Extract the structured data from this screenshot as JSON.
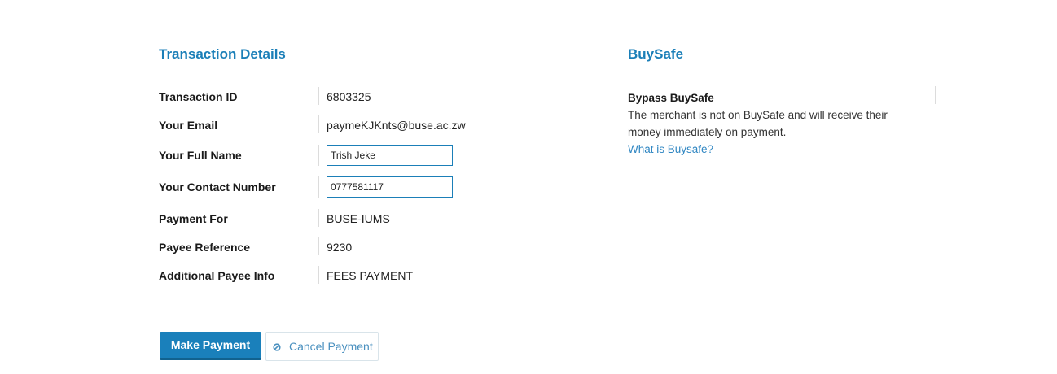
{
  "transaction": {
    "title": "Transaction Details",
    "rows": [
      {
        "label": "Transaction ID",
        "value": "6803325"
      },
      {
        "label": "Your Email",
        "value": "paymeKJKnts@buse.ac.zw"
      },
      {
        "label": "Your Full Name",
        "value": "Trish Jeke"
      },
      {
        "label": "Your Contact Number",
        "value": "0777581117"
      },
      {
        "label": "Payment For",
        "value": "BUSE-IUMS"
      },
      {
        "label": "Payee Reference",
        "value": "9230"
      },
      {
        "label": "Additional Payee Info",
        "value": "FEES PAYMENT"
      }
    ]
  },
  "buysafe": {
    "title": "BuySafe",
    "heading": "Bypass BuySafe",
    "text_line1": "The merchant is not on BuySafe and will receive their",
    "text_line2": "money immediately on payment.",
    "link": "What is Buysafe?"
  },
  "actions": {
    "make_payment": "Make Payment",
    "cancel_payment": "Cancel Payment",
    "cancel_icon": "block-icon"
  },
  "colors": {
    "accent": "#1b7fb8",
    "primary_button": "#1a80bb",
    "link": "#2f86c2"
  }
}
